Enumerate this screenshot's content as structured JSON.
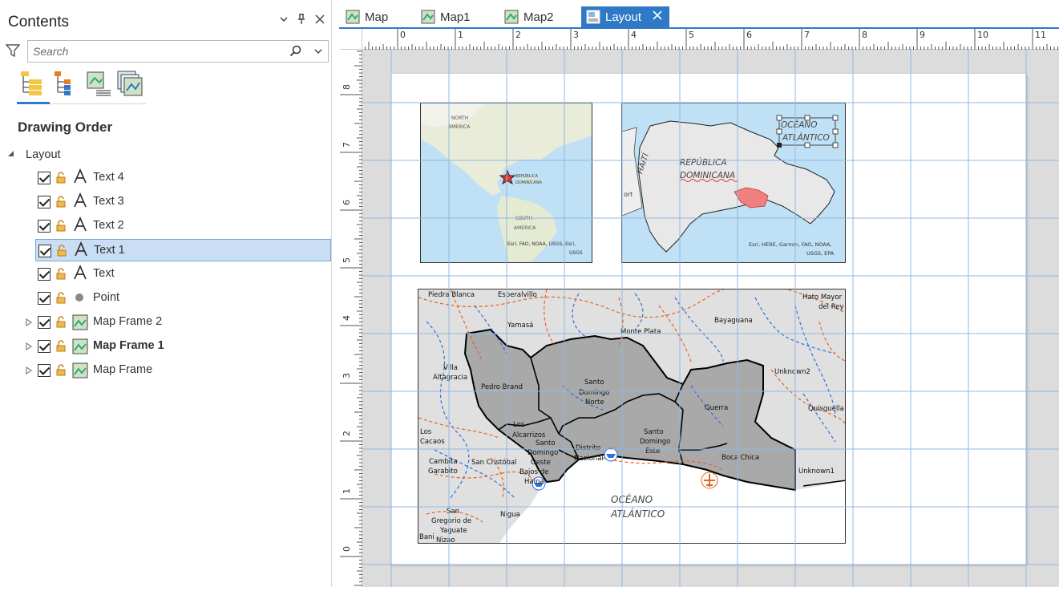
{
  "contents": {
    "title": "Contents",
    "search_placeholder": "Search",
    "section_title": "Drawing Order",
    "root_label": "Layout",
    "items": [
      {
        "label": "Text 4",
        "type": "text"
      },
      {
        "label": "Text 3",
        "type": "text"
      },
      {
        "label": "Text 2",
        "type": "text"
      },
      {
        "label": "Text 1",
        "type": "text",
        "selected": true
      },
      {
        "label": "Text",
        "type": "text"
      },
      {
        "label": "Point",
        "type": "point"
      },
      {
        "label": "Map Frame 2",
        "type": "mapframe"
      },
      {
        "label": "Map Frame 1",
        "type": "mapframe",
        "bold": true
      },
      {
        "label": "Map Frame",
        "type": "mapframe"
      }
    ]
  },
  "tabs": [
    {
      "label": "Map",
      "icon": "map-icon"
    },
    {
      "label": "Map1",
      "icon": "map-icon"
    },
    {
      "label": "Map2",
      "icon": "map-icon"
    },
    {
      "label": "Layout",
      "icon": "layout-icon",
      "active": true
    }
  ],
  "rulers": {
    "horizontal": [
      "0",
      "1",
      "2",
      "3",
      "4",
      "5",
      "6",
      "7",
      "8",
      "9",
      "10",
      "11"
    ],
    "vertical": [
      "8",
      "7",
      "6",
      "5",
      "4",
      "3",
      "2",
      "1",
      "0"
    ]
  },
  "map_frame_1": {
    "labels": [
      "NORTH",
      "AMERICA",
      "SOUTH",
      "AMERICA",
      "REPÚBLICA",
      "DOMINICANA"
    ],
    "credit_line1": "Esri, FAO, NOAA, USGS, Esri,",
    "credit_line2": "USGS"
  },
  "map_frame_2": {
    "country_label_1": "REPÚBLICA",
    "country_label_2": "DOMINICANA",
    "haiti_label": "HAITÍ",
    "port_label": "ort",
    "ocean_label_1": "OCÉANO",
    "ocean_label_2": "ATLÁNTICO",
    "credit_line1": "Esri, HERE, Garmin, FAO, NOAA,",
    "credit_line2": "USGS, EPA"
  },
  "map_frame_main": {
    "places": [
      {
        "name": "Piedra  Blanca"
      },
      {
        "name": "Esperalvillo"
      },
      {
        "name": "Hato Mayor"
      },
      {
        "name": "del Rey"
      },
      {
        "name": "Yamasá"
      },
      {
        "name": "Monte Plata"
      },
      {
        "name": "Bayaguana"
      },
      {
        "name": "Villa"
      },
      {
        "name": "Altagracia"
      },
      {
        "name": "Pedro Brand"
      },
      {
        "name": "Santo"
      },
      {
        "name": "Domingo"
      },
      {
        "name": "Norte"
      },
      {
        "name": "Unknown2"
      },
      {
        "name": "Quisquella"
      },
      {
        "name": "Guerra"
      },
      {
        "name": "Los"
      },
      {
        "name": "Alcarrizos"
      },
      {
        "name": "Los"
      },
      {
        "name": "Cacaos"
      },
      {
        "name": "Santo"
      },
      {
        "name": "Domingo"
      },
      {
        "name": "Oeste"
      },
      {
        "name": "Distrito"
      },
      {
        "name": "Nacional"
      },
      {
        "name": "Santo"
      },
      {
        "name": "Domingo"
      },
      {
        "name": "Este"
      },
      {
        "name": "Boca Chica"
      },
      {
        "name": "Cambita"
      },
      {
        "name": "Garabito"
      },
      {
        "name": "San Cristóbal"
      },
      {
        "name": "Bajos de"
      },
      {
        "name": "Haina"
      },
      {
        "name": "Unknown1"
      },
      {
        "name": "San"
      },
      {
        "name": "Gregorio de"
      },
      {
        "name": "Yaguate"
      },
      {
        "name": "Nizao"
      },
      {
        "name": "Bani"
      },
      {
        "name": "Nigua"
      }
    ],
    "ocean_label_1": "OCÉANO",
    "ocean_label_2": "ATLÁNTICO"
  },
  "colors": {
    "accent": "#2f79c6",
    "selection": "#c9def4",
    "province_fill": "#a9a9a9",
    "land_fill": "#e0e0e0",
    "river": "#2e6fe0",
    "road": "#e8631b",
    "highlight": "#f08080"
  }
}
